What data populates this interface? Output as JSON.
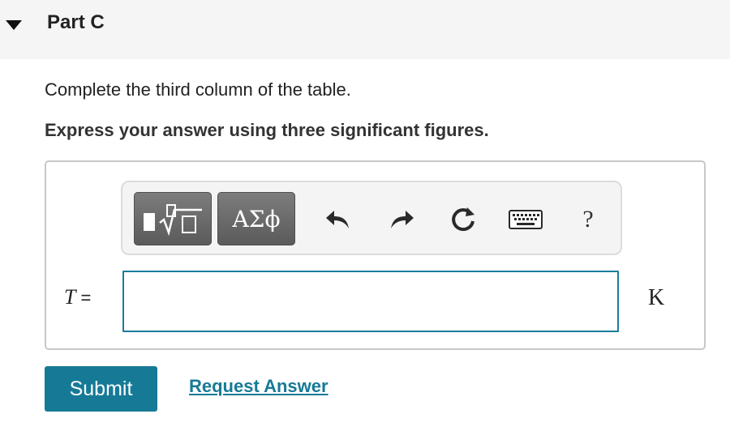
{
  "part": {
    "title": "Part C",
    "expand_icon": "triangle-down-icon"
  },
  "instructions": "Complete the third column of the table.",
  "emphasis": "Express your answer using three significant figures.",
  "toolbar": {
    "templates_icon": "templates-sqrt-icon",
    "symbols_label": "ΑΣϕ",
    "undo_icon": "undo-icon",
    "redo_icon": "redo-icon",
    "reset_icon": "reset-icon",
    "keyboard_icon": "keyboard-icon",
    "help_label": "?"
  },
  "answer": {
    "variable": "T",
    "equals": "=",
    "value": "",
    "unit": "K"
  },
  "actions": {
    "submit_label": "Submit",
    "request_label": "Request Answer"
  },
  "colors": {
    "accent": "#167a97",
    "header_bg": "#f5f5f5",
    "toolbar_button": "#6b6b6b"
  }
}
